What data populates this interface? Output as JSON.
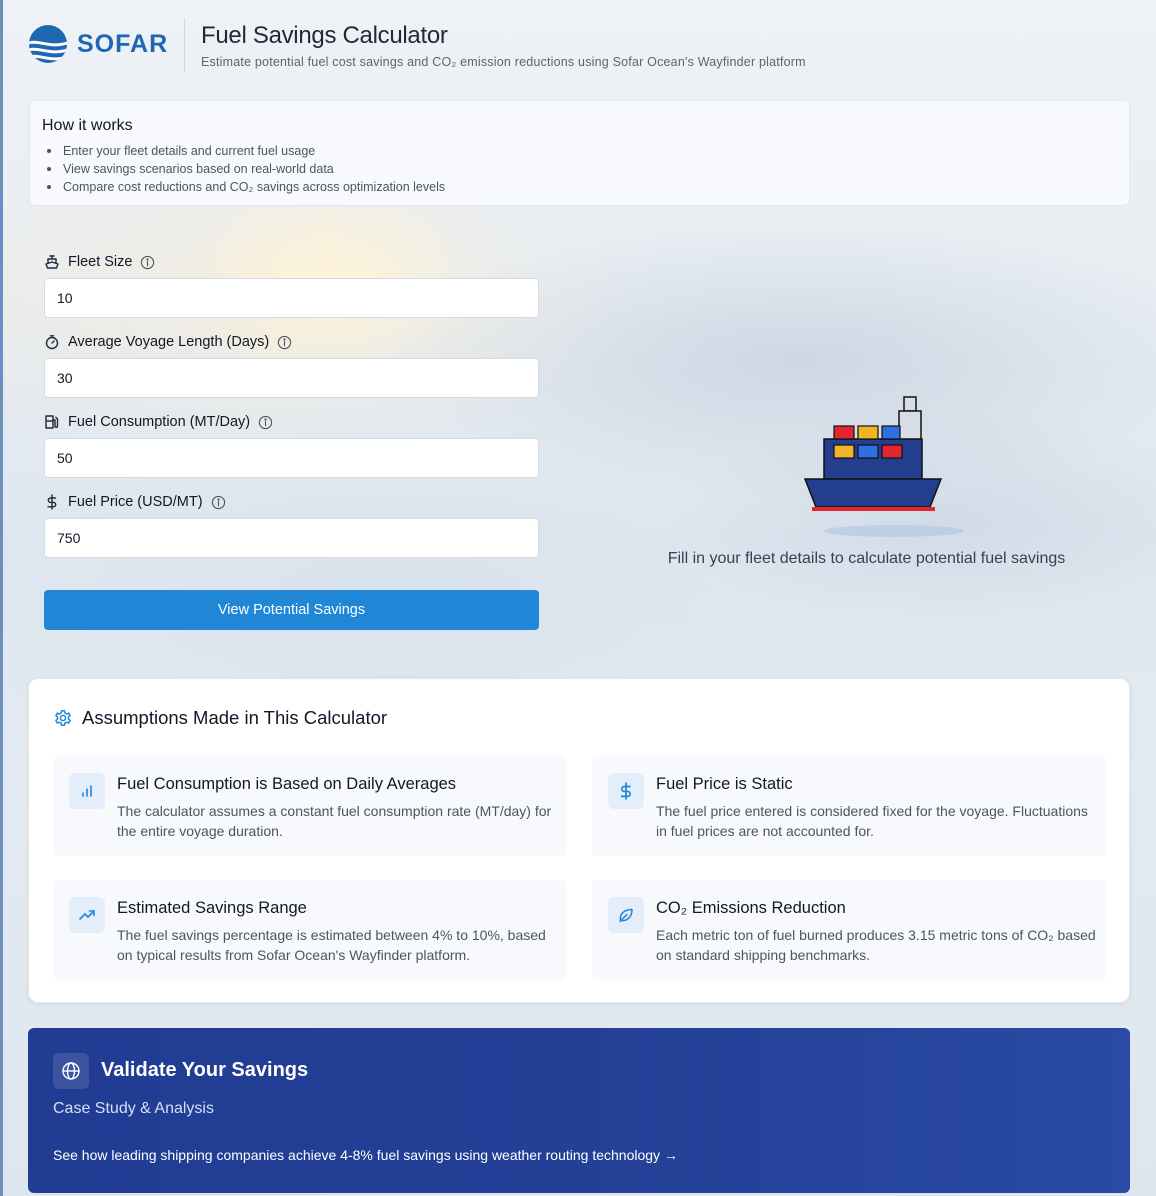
{
  "header": {
    "logo_text": "SOFAR",
    "title": "Fuel Savings Calculator",
    "subtitle": "Estimate potential fuel cost savings and CO₂ emission reductions using Sofar Ocean's Wayfinder platform"
  },
  "how_it_works": {
    "title": "How it works",
    "items": [
      "Enter your fleet details and current fuel usage",
      "View savings scenarios based on real-world data",
      "Compare cost reductions and CO₂ savings across optimization levels"
    ]
  },
  "form": {
    "fields": [
      {
        "label": "Fleet Size",
        "value": "10",
        "icon": "ship-icon"
      },
      {
        "label": "Average Voyage Length (Days)",
        "value": "30",
        "icon": "timer-icon"
      },
      {
        "label": "Fuel Consumption (MT/Day)",
        "value": "50",
        "icon": "fuel-pump-icon"
      },
      {
        "label": "Fuel Price (USD/MT)",
        "value": "750",
        "icon": "dollar-icon"
      }
    ],
    "submit_label": "View Potential Savings"
  },
  "empty_state": {
    "message": "Fill in your fleet details to calculate potential fuel savings",
    "illustration": "container-ship-illustration"
  },
  "assumptions": {
    "title": "Assumptions Made in This Calculator",
    "cards": [
      {
        "title": "Fuel Consumption is Based on Daily Averages",
        "text": "The calculator assumes a constant fuel consumption rate (MT/day) for the entire voyage duration.",
        "icon": "bar-chart-icon"
      },
      {
        "title": "Fuel Price is Static",
        "text": "The fuel price entered is considered fixed for the voyage. Fluctuations in fuel prices are not accounted for.",
        "icon": "dollar-icon"
      },
      {
        "title": "Estimated Savings Range",
        "text": "The fuel savings percentage is estimated between 4% to 10%, based on typical results from Sofar Ocean's Wayfinder platform.",
        "icon": "trending-up-icon"
      },
      {
        "title": "CO₂ Emissions Reduction",
        "text": "Each metric ton of fuel burned produces 3.15 metric tons of CO₂ based on standard shipping benchmarks.",
        "icon": "leaf-icon"
      }
    ]
  },
  "validate": {
    "title": "Validate Your Savings",
    "subtitle": "Case Study & Analysis",
    "link_text": "See how leading shipping companies achieve 4-8% fuel savings using weather routing technology →"
  },
  "colors": {
    "brand": "#1f66b3",
    "button": "#1f87d6",
    "banner": "#233f96"
  }
}
